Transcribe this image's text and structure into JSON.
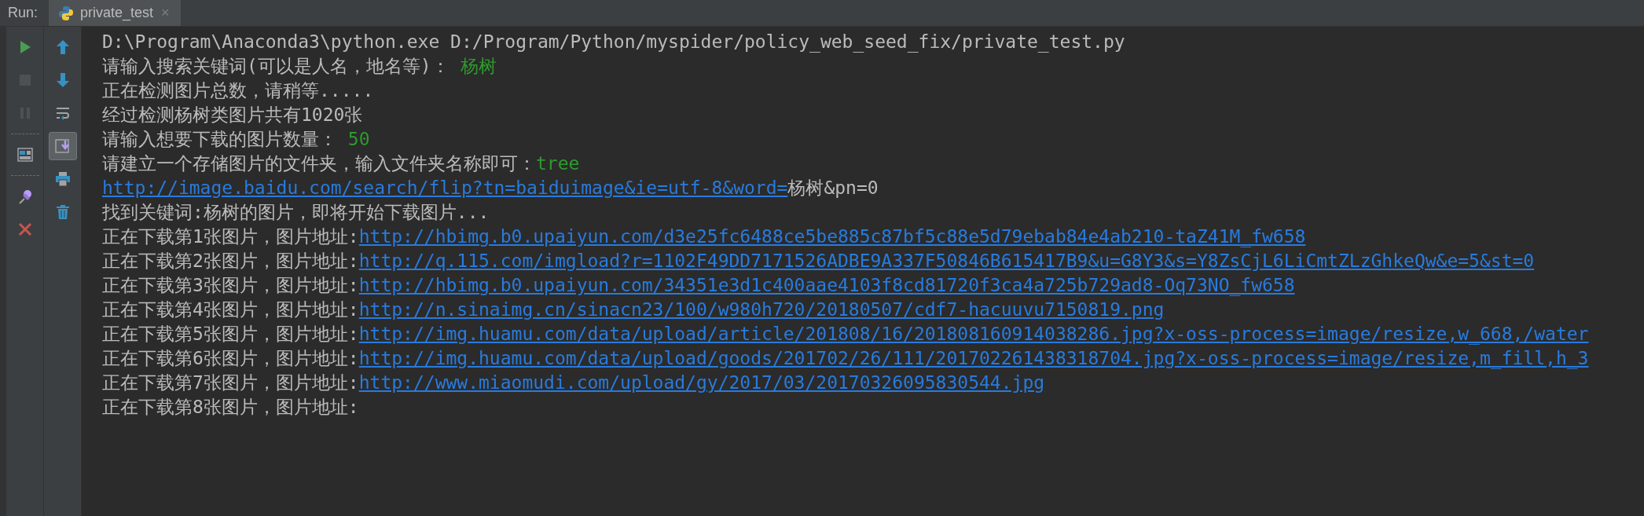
{
  "run_label": "Run:",
  "tabs": [
    {
      "label": "private_test",
      "selected": true,
      "close": "×"
    }
  ],
  "left_toolbar": [
    {
      "kind": "run",
      "disabled": false
    },
    {
      "kind": "stop",
      "disabled": true
    },
    {
      "kind": "pause",
      "disabled": true
    },
    {
      "kind": "separator"
    },
    {
      "kind": "layout",
      "disabled": false
    },
    {
      "kind": "separator"
    },
    {
      "kind": "pin",
      "disabled": false
    },
    {
      "kind": "close",
      "disabled": false
    }
  ],
  "console_toolbar": [
    {
      "kind": "up",
      "on": false
    },
    {
      "kind": "down",
      "on": false
    },
    {
      "kind": "wrap",
      "on": false
    },
    {
      "kind": "scroll_end",
      "on": true
    },
    {
      "kind": "print",
      "on": false
    },
    {
      "kind": "trash",
      "on": false
    }
  ],
  "console_lines": [
    {
      "segments": [
        {
          "kind": "text",
          "text": "D:\\Program\\Anaconda3\\python.exe D:/Program/Python/myspider/policy_web_seed_fix/private_test.py"
        }
      ]
    },
    {
      "segments": [
        {
          "kind": "text",
          "text": "请输入搜索关键词(可以是人名，地名等)： "
        },
        {
          "kind": "input",
          "text": "杨树"
        }
      ]
    },
    {
      "segments": [
        {
          "kind": "text",
          "text": "正在检测图片总数，请稍等....."
        }
      ]
    },
    {
      "segments": [
        {
          "kind": "text",
          "text": "经过检测杨树类图片共有1020张"
        }
      ]
    },
    {
      "segments": [
        {
          "kind": "text",
          "text": "请输入想要下载的图片数量： "
        },
        {
          "kind": "input",
          "text": "50"
        }
      ]
    },
    {
      "segments": [
        {
          "kind": "text",
          "text": "请建立一个存储图片的文件夹，输入文件夹名称即可："
        },
        {
          "kind": "input",
          "text": "tree"
        }
      ]
    },
    {
      "segments": [
        {
          "kind": "link",
          "text": "http://image.baidu.com/search/flip?tn=baiduimage&ie=utf-8&word="
        },
        {
          "kind": "text",
          "text": "杨树&pn=0"
        }
      ]
    },
    {
      "segments": [
        {
          "kind": "text",
          "text": "找到关键词:杨树的图片，即将开始下载图片..."
        }
      ]
    },
    {
      "segments": [
        {
          "kind": "text",
          "text": "正在下载第1张图片，图片地址:"
        },
        {
          "kind": "link",
          "text": "http://hbimg.b0.upaiyun.com/d3e25fc6488ce5be885c87bf5c88e5d79ebab84e4ab210-taZ41M_fw658"
        }
      ]
    },
    {
      "segments": [
        {
          "kind": "text",
          "text": "正在下载第2张图片，图片地址:"
        },
        {
          "kind": "link",
          "text": "http://q.115.com/imgload?r=1102F49DD7171526ADBE9A337F50846B615417B9&u=G8Y3&s=Y8ZsCjL6LiCmtZLzGhkeQw&e=5&st=0"
        }
      ]
    },
    {
      "segments": [
        {
          "kind": "text",
          "text": "正在下载第3张图片，图片地址:"
        },
        {
          "kind": "link",
          "text": "http://hbimg.b0.upaiyun.com/34351e3d1c400aae4103f8cd81720f3ca4a725b729ad8-Oq73NO_fw658"
        }
      ]
    },
    {
      "segments": [
        {
          "kind": "text",
          "text": "正在下载第4张图片，图片地址:"
        },
        {
          "kind": "link",
          "text": "http://n.sinaimg.cn/sinacn23/100/w980h720/20180507/cdf7-hacuuvu7150819.png"
        }
      ]
    },
    {
      "segments": [
        {
          "kind": "text",
          "text": "正在下载第5张图片，图片地址:"
        },
        {
          "kind": "link",
          "text": "http://img.huamu.com/data/upload/article/201808/16/201808160914038286.jpg?x-oss-process=image/resize,w_668,/water"
        }
      ]
    },
    {
      "segments": [
        {
          "kind": "text",
          "text": "正在下载第6张图片，图片地址:"
        },
        {
          "kind": "link",
          "text": "http://img.huamu.com/data/upload/goods/201702/26/111/201702261438318704.jpg?x-oss-process=image/resize,m_fill,h_3"
        }
      ]
    },
    {
      "segments": [
        {
          "kind": "text",
          "text": "正在下载第7张图片，图片地址:"
        },
        {
          "kind": "link",
          "text": "http://www.miaomudi.com/upload/gy/2017/03/20170326095830544.jpg"
        }
      ]
    },
    {
      "segments": [
        {
          "kind": "text",
          "text": "正在下载第8张图片，图片地址:"
        }
      ]
    }
  ]
}
